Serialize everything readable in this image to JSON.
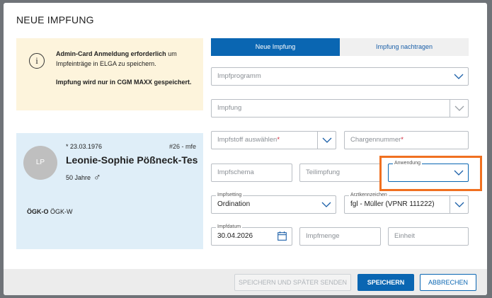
{
  "dialog": {
    "title": "NEUE IMPFUNG"
  },
  "info": {
    "icon": "info-icon",
    "line1_bold": "Admin-Card Anmeldung erforderlich",
    "line1_rest": " um Impfeinträge in ELGA zu speichern.",
    "line2": "Impfung wird nur in CGM MAXX gespeichert."
  },
  "patient": {
    "initials": "LP",
    "dob": "* 23.03.1976",
    "number": "#26 - mfe",
    "name": "Leonie-Sophie Pößneck-Tes…",
    "age": "50 Jahre",
    "gender_symbol": "♂",
    "insurer_bold": "ÖGK-O",
    "insurer_rest": "ÖGK-W"
  },
  "tabs": [
    {
      "label": "Neue Impfung",
      "active": true
    },
    {
      "label": "Impfung nachtragen",
      "active": false
    }
  ],
  "form": {
    "impfprogramm": {
      "placeholder": "Impfprogramm"
    },
    "impfung": {
      "placeholder": "Impfung"
    },
    "impfstoff": {
      "placeholder": "Impfstoff auswählen",
      "required_mark": "*"
    },
    "chargennummer": {
      "placeholder": "Chargennummer",
      "required_mark": "*"
    },
    "impfschema": {
      "placeholder": "Impfschema"
    },
    "teilimpfung": {
      "placeholder": "Teilimpfung"
    },
    "anwendung": {
      "label": "Anwendung",
      "value": ""
    },
    "impfsetting": {
      "label": "Impfsetting",
      "value": "Ordination"
    },
    "arztkennzeichen": {
      "label": "Arztkennzeichen",
      "value": "fgl - Müller (VPNR 111222)"
    },
    "impfdatum": {
      "label": "Impfdatum",
      "value": "30.04.2026"
    },
    "impfmenge": {
      "placeholder": "Impfmenge"
    },
    "einheit": {
      "placeholder": "Einheit"
    }
  },
  "footer": {
    "save_later": "SPEICHERN UND SPÄTER SENDEN",
    "save": "SPEICHERN",
    "cancel": "ABBRECHEN"
  },
  "colors": {
    "primary": "#0a66b2",
    "highlight": "#f07020",
    "info_bg": "#fdf4dc",
    "patient_bg": "#dfeef8",
    "required": "#d0263a"
  }
}
